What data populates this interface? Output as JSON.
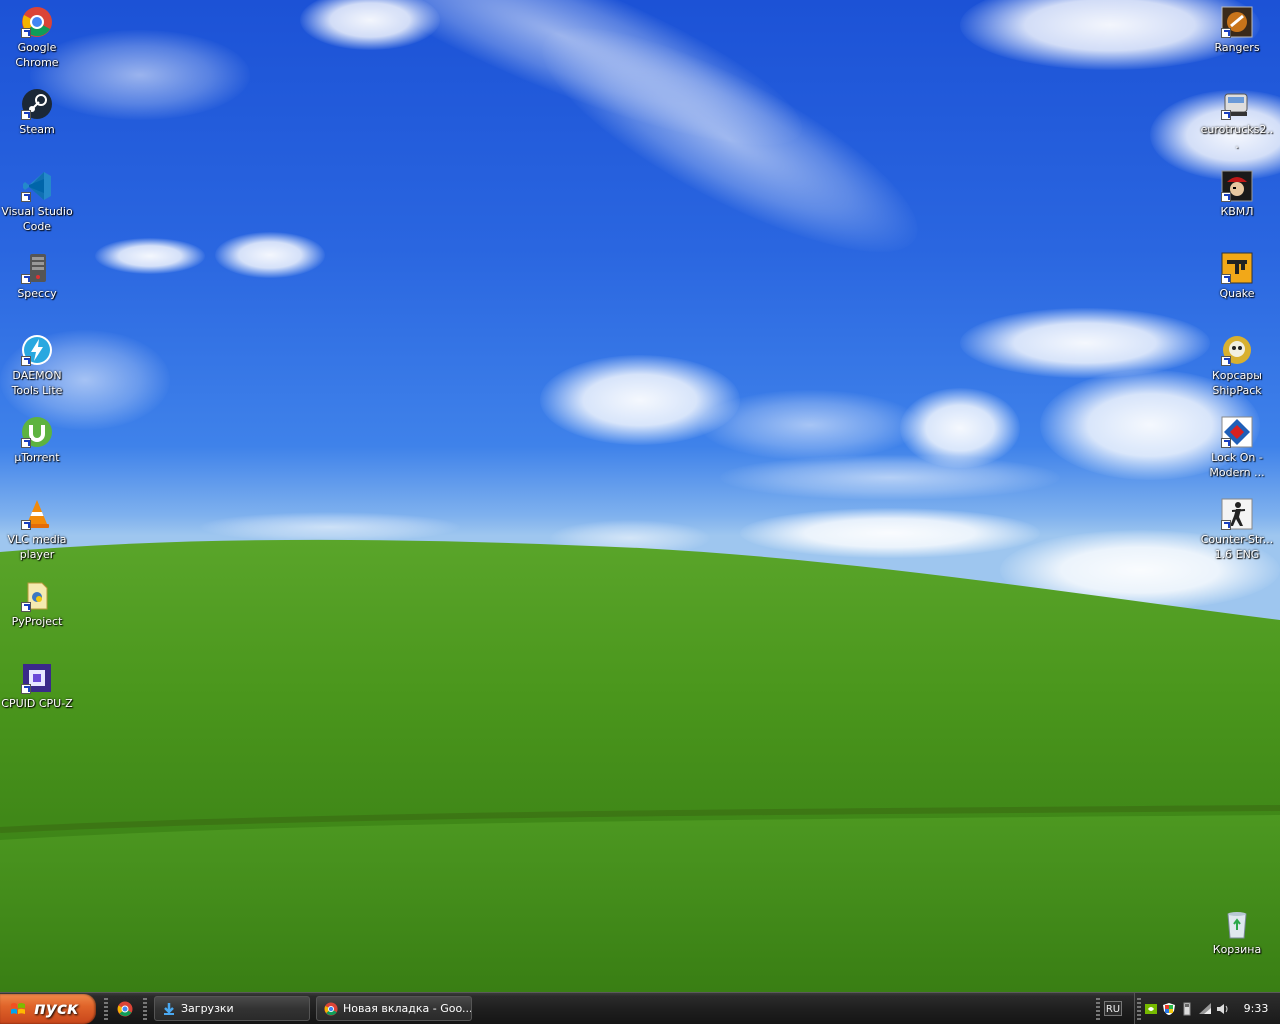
{
  "desktop": {
    "left_icons": [
      {
        "id": "chrome",
        "label": "Google Chrome",
        "icon": "chrome-icon"
      },
      {
        "id": "steam",
        "label": "Steam",
        "icon": "steam-icon"
      },
      {
        "id": "vscode",
        "label": "Visual Studio Code",
        "icon": "vscode-icon"
      },
      {
        "id": "speccy",
        "label": "Speccy",
        "icon": "speccy-icon"
      },
      {
        "id": "daemon",
        "label": "DAEMON Tools Lite",
        "icon": "daemon-tools-icon"
      },
      {
        "id": "utorrent",
        "label": "µTorrent",
        "icon": "utorrent-icon"
      },
      {
        "id": "vlc",
        "label": "VLC media player",
        "icon": "vlc-icon"
      },
      {
        "id": "pyproject",
        "label": "PyProject",
        "icon": "document-icon"
      },
      {
        "id": "cpuz",
        "label": "CPUID CPU-Z",
        "icon": "cpuz-icon"
      }
    ],
    "right_icons": [
      {
        "id": "rangers",
        "label": "Rangers",
        "icon": "rangers-icon"
      },
      {
        "id": "eurotrucks",
        "label": "eurotrucks2...",
        "icon": "truck-icon"
      },
      {
        "id": "kvml",
        "label": "КВМЛ",
        "icon": "pirate-icon"
      },
      {
        "id": "quake",
        "label": "Quake",
        "icon": "quake-icon"
      },
      {
        "id": "korsary",
        "label": "Корсары ShipPack",
        "icon": "skull-icon"
      },
      {
        "id": "lockon",
        "label": "Lock On - Modern ...",
        "icon": "lockon-icon"
      },
      {
        "id": "counterstrike",
        "label": "Counter-Str... 1.6 ENG",
        "icon": "counter-strike-icon"
      }
    ],
    "recycle_bin": {
      "label": "Корзина",
      "icon": "recycle-bin-icon"
    }
  },
  "taskbar": {
    "start_label": "пуск",
    "quick_launch": [
      {
        "icon": "chrome-icon"
      }
    ],
    "tasks": [
      {
        "label": "Загрузки",
        "icon": "download-folder-icon"
      },
      {
        "label": "Новая вкладка - Goo...",
        "icon": "chrome-icon"
      }
    ],
    "language": "RU",
    "tray_icons": [
      "nvidia-icon",
      "security-shield-icon",
      "usb-icon",
      "wifi-icon",
      "volume-icon"
    ],
    "clock": "9:33"
  },
  "colors": {
    "sky_top": "#1c52d6",
    "grass": "#4a9a1c",
    "start_button": "#e0642a",
    "taskbar": "#1f1f1f"
  }
}
